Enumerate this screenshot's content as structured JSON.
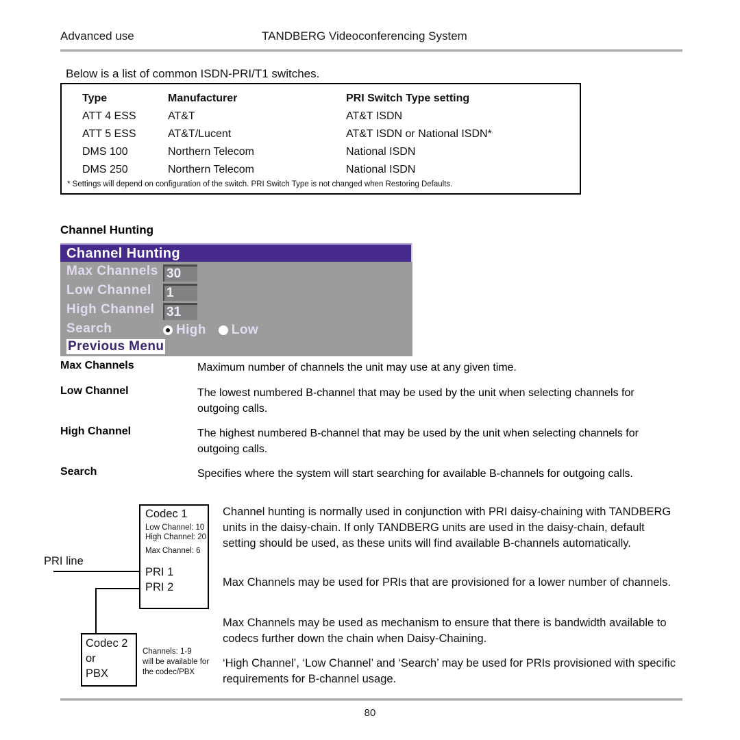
{
  "page": {
    "running_head_left": "Advanced use",
    "running_head_center": "TANDBERG Videoconferencing System",
    "folio": "80",
    "intro": "Below is a list of common ISDN-PRI/T1 switches."
  },
  "switch_table": {
    "headers": [
      "Type",
      "Manufacturer",
      "PRI Switch Type setting"
    ],
    "rows": [
      [
        "ATT 4 ESS",
        "AT&T",
        "AT&T ISDN"
      ],
      [
        "ATT 5 ESS",
        "AT&T/Lucent",
        "AT&T ISDN or National ISDN*"
      ],
      [
        "DMS 100",
        "Northern  Telecom",
        "National  ISDN"
      ],
      [
        "DMS 250",
        "Northern  Telecom",
        "National  ISDN"
      ]
    ],
    "footnote": "* Settings will depend on configuration of the switch. PRI Switch Type is not changed when Restoring Defaults."
  },
  "section": {
    "heading": "Channel Hunting"
  },
  "osd": {
    "title": "Channel Hunting",
    "colors": {
      "title_bar": "#452a8c",
      "body": "#9c9c9c",
      "value_box": "#828282",
      "label_text": "#e3dcf0",
      "selected_item_bg": "#ffffff",
      "selected_item_text": "#3b2470"
    },
    "fields": [
      {
        "label": "Max Channels",
        "value": "30"
      },
      {
        "label": "Low Channel",
        "value": "1"
      },
      {
        "label": "High Channel",
        "value": "31"
      }
    ],
    "search": {
      "label": "Search",
      "options": [
        "High",
        "Low"
      ],
      "selected": "High"
    },
    "previous_menu": "Previous Menu"
  },
  "definitions": [
    {
      "term": "Max Channels",
      "body": "Maximum number of channels the unit may use at any given time."
    },
    {
      "term": "Low Channel",
      "body": "The lowest numbered B-channel that may be used by the unit when selecting channels for outgoing calls."
    },
    {
      "term": "High Channel",
      "body": "The highest numbered B-channel that may be used by the unit when selecting channels for outgoing calls."
    },
    {
      "term": "Search",
      "body": "Specifies where the system will start searching for available B-channels for outgoing calls."
    }
  ],
  "paragraphs": [
    "Channel hunting is normally used in conjunction with PRI daisy-chaining with TANDBERG units in the daisy-chain. If only TANDBERG units are used in the daisy-chain, default setting should be used, as these units will find available B-channels automatically.",
    "Max Channels may be used for PRIs that are provisioned for a lower number of channels.",
    "Max Channels may be used as mechanism to ensure that there is bandwidth available to codecs further down the chain when Daisy-Chaining.",
    "‘High Channel’, ‘Low Channel’ and ‘Search’ may be used for PRIs provisioned with specific requirements for B-channel usage."
  ],
  "diagram": {
    "pri_line_label": "PRI line",
    "codec1": {
      "title": "Codec 1",
      "low_channel": "Low Channel: 10",
      "high_channel": "High Channel: 20",
      "max_channel": "Max Channel: 6",
      "port1": "PRI 1",
      "port2": "PRI 2"
    },
    "codec2": {
      "line1": "Codec 2",
      "line2": "or",
      "line3": "PBX"
    },
    "note": {
      "line1": "Channels: 1-9",
      "line2": "will be available for",
      "line3": "the codec/PBX"
    }
  }
}
